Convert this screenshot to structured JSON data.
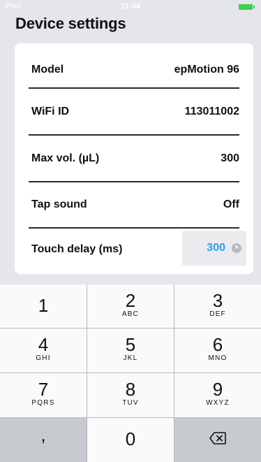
{
  "status_bar": {
    "carrier": "iPod",
    "time": "11:44",
    "battery_color": "#3ccf4e"
  },
  "title": "Device settings",
  "settings": {
    "model": {
      "label": "Model",
      "value": "epMotion 96"
    },
    "wifi": {
      "label": "WiFi ID",
      "value": "113011002"
    },
    "max_vol": {
      "label": "Max vol. (µL)",
      "value": "300"
    },
    "tap_sound": {
      "label": "Tap sound",
      "value": "Off"
    },
    "touch_delay": {
      "label": "Touch delay (ms)",
      "value": "300",
      "value_color": "#2e9ee8"
    }
  },
  "keypad": {
    "k1": {
      "digit": "1"
    },
    "k2": {
      "digit": "2",
      "letters": "ABC"
    },
    "k3": {
      "digit": "3",
      "letters": "DEF"
    },
    "k4": {
      "digit": "4",
      "letters": "GHI"
    },
    "k5": {
      "digit": "5",
      "letters": "JKL"
    },
    "k6": {
      "digit": "6",
      "letters": "MNO"
    },
    "k7": {
      "digit": "7",
      "letters": "PQRS"
    },
    "k8": {
      "digit": "8",
      "letters": "TUV"
    },
    "k9": {
      "digit": "9",
      "letters": "WXYZ"
    },
    "comma": ",",
    "k0": {
      "digit": "0"
    },
    "backspace_icon": "backspace-icon"
  }
}
